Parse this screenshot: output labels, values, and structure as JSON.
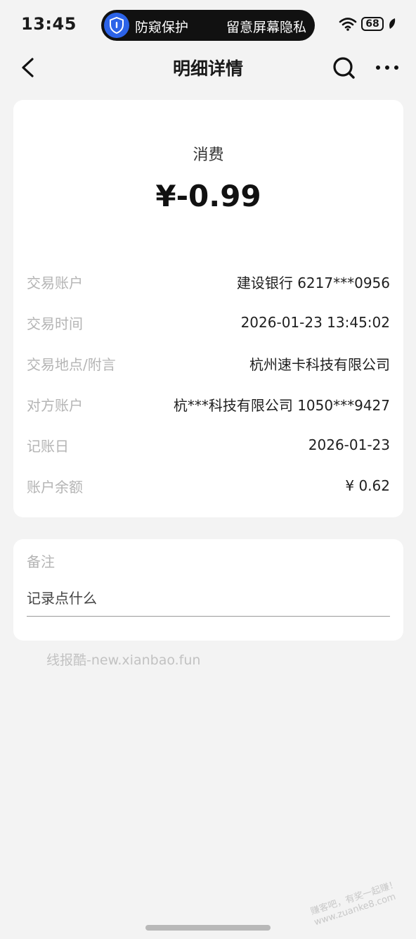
{
  "status_bar": {
    "time": "13:45",
    "privacy_left": "防窥保护",
    "privacy_right": "留意屏幕隐私",
    "battery": "68"
  },
  "nav": {
    "title": "明细详情",
    "back_icon": "chevron-left-icon",
    "search_icon": "search-icon",
    "more_icon": "more-dots-icon"
  },
  "transaction": {
    "type": "消费",
    "amount": "¥-0.99",
    "rows": [
      {
        "label": "交易账户",
        "value": "建设银行 6217***0956"
      },
      {
        "label": "交易时间",
        "value": "2026-01-23 13:45:02"
      },
      {
        "label": "交易地点/附言",
        "value": "杭州速卡科技有限公司"
      },
      {
        "label": "对方账户",
        "value": "杭***科技有限公司 1050***9427"
      },
      {
        "label": "记账日",
        "value": "2026-01-23"
      },
      {
        "label": "账户余额",
        "value": "¥ 0.62"
      }
    ]
  },
  "memo": {
    "label": "备注",
    "placeholder": "记录点什么"
  },
  "watermark": {
    "text": "线报酷-new.xianbao.fun",
    "corner_line1": "赚客吧，有奖一起赚！",
    "corner_line2": "www.zuanke8.com"
  },
  "colors": {
    "background": "#f3f3f3",
    "card": "#ffffff",
    "label_gray": "#b4b4b4",
    "shield_blue": "#2c63e8"
  }
}
